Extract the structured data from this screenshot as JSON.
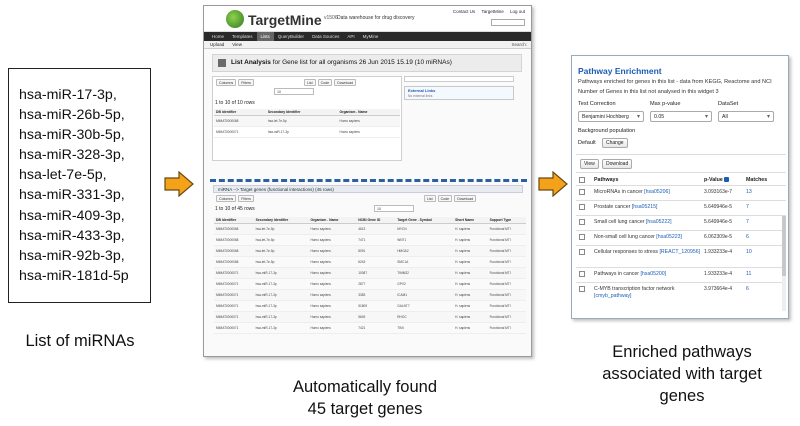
{
  "mirnas": [
    "hsa-miR-17-3p,",
    "hsa-miR-26b-5p,",
    "hsa-miR-30b-5p,",
    "hsa-miR-328-3p,",
    "hsa-let-7e-5p,",
    "hsa-miR-331-3p,",
    "hsa-miR-409-3p,",
    "hsa-miR-433-3p,",
    "hsa-miR-92b-3p,",
    "hsa-miR-181d-5p"
  ],
  "captions": {
    "left": "List of miRNAs",
    "middle_line1": "Automatically found",
    "middle_line2": "45 target genes",
    "right_line1": "Enriched pathways",
    "right_line2": "associated with target",
    "right_line3": "genes"
  },
  "colors": {
    "arrow_fill": "#f5a21b",
    "arrow_stroke": "#6b4a10",
    "link_blue": "#1c5db4",
    "dashed_line": "#2a5fa0"
  },
  "targetmine": {
    "brand": "TargetMine",
    "version": "v1506",
    "tagline": "Data warehouse for drug discovery",
    "top_links": [
      "Contact Us",
      "TargetMine",
      "Log out"
    ],
    "nav": [
      "Home",
      "Templates",
      "Lists",
      "QueryBuilder",
      "Data Sources",
      "API",
      "MyMine"
    ],
    "nav_active": "Lists",
    "subnav": [
      "Upload",
      "View"
    ],
    "search_label": "Search:",
    "page_title_bold": "List Analysis",
    "page_title_rest": "for Gene list for all organisms 26 Jun 2015 15.19 (10 miRNAs)",
    "buttons": [
      "Columns",
      "Filters",
      "List",
      "Code",
      "Download"
    ],
    "rows_label_1": "1 to 10 of 10 rows",
    "page_size": "10",
    "table1_headers": [
      "DB identifier",
      "Secondary Identifier",
      "Organism . Name"
    ],
    "table1_rows": [
      [
        "MIMAT0000068",
        "hsa-let-7e-5p",
        "Homo sapiens"
      ],
      [
        "MIMAT0000071",
        "hsa-miR-17-3p",
        "Homo sapiens"
      ]
    ],
    "external_links_title": "External Links",
    "external_links_sub": "No external links",
    "section2_title": "miRNA --> Target genes (functional interactions)",
    "section2_count": "(45 rows)",
    "rows_label_2": "1 to 10 of 45 rows",
    "table2_headers": [
      "DB identifier",
      "Secondary Identifier",
      "Organism . Name",
      "NCBI Gene ID",
      "Target Gene . Symbol",
      "Short Name",
      "Support Type"
    ],
    "table2_rows": [
      [
        "MIMAT0000068",
        "hsa-let-7e-5p",
        "Homo sapiens",
        "4613",
        "MYCN",
        "H. sapiens",
        "Functional MTI"
      ],
      [
        "MIMAT0000068",
        "hsa-let-7e-5p",
        "Homo sapiens",
        "7471",
        "WNT1",
        "H. sapiens",
        "Functional MTI"
      ],
      [
        "MIMAT0000068",
        "hsa-let-7e-5p",
        "Homo sapiens",
        "8091",
        "HMGA2",
        "H. sapiens",
        "Functional MTI"
      ],
      [
        "MIMAT0000068",
        "hsa-let-7e-5p",
        "Homo sapiens",
        "6243",
        "SMC1A",
        "H. sapiens",
        "Functional MTI"
      ],
      [
        "MIMAT0000071",
        "hsa-miR-17-3p",
        "Homo sapiens",
        "10087",
        "TIMM22",
        "H. sapiens",
        "Functional MTI"
      ],
      [
        "MIMAT0000071",
        "hsa-miR-17-3p",
        "Homo sapiens",
        "2877",
        "GPX2",
        "H. sapiens",
        "Functional MTI"
      ],
      [
        "MIMAT0000071",
        "hsa-miR-17-3p",
        "Homo sapiens",
        "3383",
        "ICAM1",
        "H. sapiens",
        "Functional MTI"
      ],
      [
        "MIMAT0000071",
        "hsa-miR-17-3p",
        "Homo sapiens",
        "51809",
        "GALNT7",
        "H. sapiens",
        "Functional MTI"
      ],
      [
        "MIMAT0000071",
        "hsa-miR-17-3p",
        "Homo sapiens",
        "5649",
        "RHOC",
        "H. sapiens",
        "Functional MTI"
      ],
      [
        "MIMAT0000071",
        "hsa-miR-17-3p",
        "Homo sapiens",
        "7421",
        "TIMI",
        "H. sapiens",
        "Functional MTI"
      ]
    ]
  },
  "pathway": {
    "title": "Pathway Enrichment",
    "desc1": "Pathways enriched for genes in this list - data from KEGG, Reactome and NCI",
    "desc2": "Number of Genes in this list not analysed in this widget",
    "desc2_count": "3",
    "test_correction_label": "Test Correction",
    "test_correction_value": "Benjamini Hochberg",
    "max_p_label": "Max p-value",
    "max_p_value": "0.05",
    "dataset_label": "DataSet",
    "dataset_value": "All",
    "background_label": "Background population",
    "default_label": "Default",
    "change_button": "Change",
    "view_button": "View",
    "download_button": "Download",
    "col_pathways": "Pathways",
    "col_pvalue": "p-Value",
    "col_matches": "Matches",
    "rows": [
      {
        "name": "MicroRNAs in cancer",
        "id": "[hsa05206]",
        "p": "3.093163e-7",
        "m": "13"
      },
      {
        "name": "Prostate cancer",
        "id": "[hsa05215]",
        "p": "5.649946e-5",
        "m": "7"
      },
      {
        "name": "Small cell lung cancer",
        "id": "[hsa05222]",
        "p": "5.649946e-5",
        "m": "7"
      },
      {
        "name": "Non-small cell lung cancer",
        "id": "[hsa05223]",
        "p": "6.062309e-5",
        "m": "6"
      },
      {
        "name": "Cellular responses to stress",
        "id": "[REACT_120956]",
        "p": "1.933233e-4",
        "m": "10"
      },
      {
        "name": "Pathways in cancer",
        "id": "[hsa05200]",
        "p": "1.933233e-4",
        "m": "11"
      },
      {
        "name": "C-MYB transcription factor network",
        "id": "[cmyb_pathway]",
        "p": "3.973664e-4",
        "m": "6"
      }
    ]
  }
}
